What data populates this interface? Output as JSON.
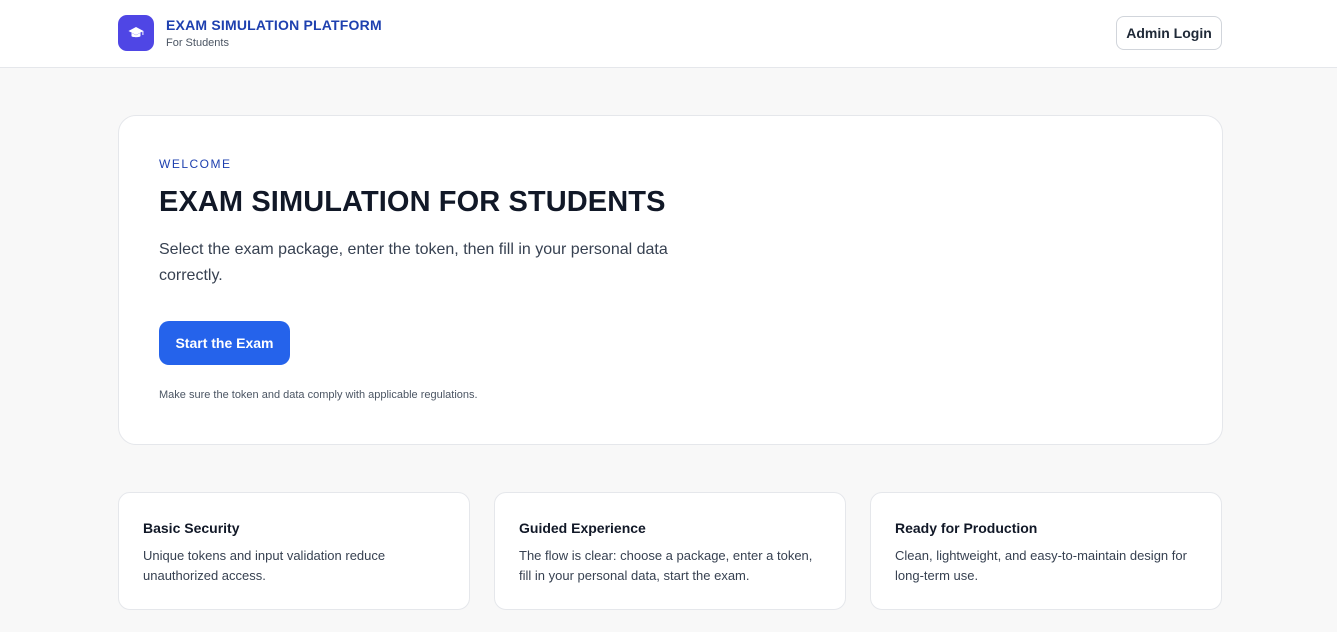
{
  "header": {
    "brand_title": "EXAM SIMULATION PLATFORM",
    "brand_subtitle": "For Students",
    "logo_icon": "graduation-cap-icon",
    "admin_login_label": "Admin Login"
  },
  "hero": {
    "eyebrow": "WELCOME",
    "title": "EXAM SIMULATION FOR STUDENTS",
    "description": "Select the exam package, enter the token, then fill in your personal data correctly.",
    "start_button_label": "Start the Exam",
    "note": "Make sure the token and data comply with applicable regulations."
  },
  "features": [
    {
      "title": "Basic Security",
      "text": "Unique tokens and input validation reduce unauthorized access."
    },
    {
      "title": "Guided Experience",
      "text": "The flow is clear: choose a package, enter a token, fill in your personal data, start the exam."
    },
    {
      "title": "Ready for Production",
      "text": "Clean, lightweight, and easy-to-maintain design for long-term use."
    }
  ],
  "colors": {
    "brand": "#4f46e5",
    "accent": "#2563eb",
    "brand_text": "#1e40af",
    "background": "#f8f8f8"
  }
}
